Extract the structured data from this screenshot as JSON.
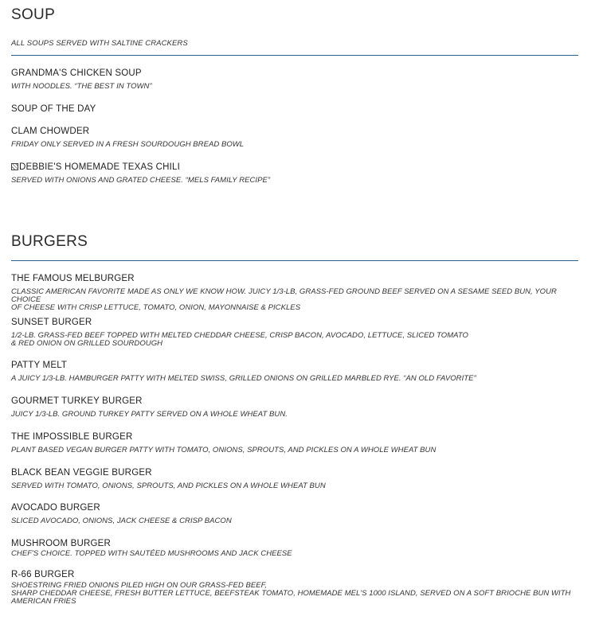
{
  "soup": {
    "title": "SOUP",
    "note": "ALL SOUPS SERVED WITH SALTINE CRACKERS",
    "items": [
      {
        "name": "GRANDMA'S CHICKEN SOUP",
        "desc": "WITH NOODLES. “THE BEST IN TOWN”"
      },
      {
        "name": "SOUP OF THE DAY",
        "desc": ""
      },
      {
        "name": "CLAM CHOWDER",
        "desc": "FRIDAY ONLY SERVED IN A FRESH SOURDOUGH BREAD BOWL"
      },
      {
        "name": "DEBBIE'S HOMEMADE TEXAS CHILI",
        "desc": "SERVED WITH ONIONS AND GRATED CHEESE. “MELS FAMILY RECIPE”",
        "icon": "missing-glyph-icon"
      }
    ]
  },
  "burgers": {
    "title": "BURGERS",
    "items": [
      {
        "name": "THE FAMOUS MELBURGER",
        "desc": "CLASSIC AMERICAN FAVORITE MADE AS ONLY WE KNOW HOW. JUICY 1/3-LB, GRASS-FED GROUND BEEF SERVED ON A SESAME SEED BUN, YOUR CHOICE\nOF CHEESE WITH CRISP LETTUCE, TOMATO, ONION, MAYONNAISE & PICKLES"
      },
      {
        "name": "SUNSET BURGER",
        "desc": "1/2-LB. GRASS-FED BEEF TOPPED WITH MELTED CHEDDAR CHEESE, CRISP BACON, AVOCADO, LETTUCE, SLICED TOMATO\n& RED ONION ON GRILLED SOURDOUGH"
      },
      {
        "name": "PATTY MELT",
        "desc": "A JUICY 1/3-LB. HAMBURGER PATTY WITH MELTED SWISS, GRILLED ONIONS ON GRILLED MARBLED RYE. “AN OLD FAVORITE”"
      },
      {
        "name": "GOURMET TURKEY BURGER",
        "desc": "JUICY 1/3-LB. GROUND TURKEY PATTY SERVED ON A WHOLE WHEAT BUN."
      },
      {
        "name": "THE IMPOSSIBLE BURGER",
        "desc": "PLANT BASED VEGAN BURGER PATTY WITH TOMATO, ONIONS, SPROUTS, AND PICKLES ON A WHOLE WHEAT BUN"
      },
      {
        "name": "BLACK BEAN VEGGIE BURGER",
        "desc": "SERVED WITH TOMATO, ONIONS, SPROUTS, AND PICKLES ON A WHOLE WHEAT BUN"
      },
      {
        "name": "AVOCADO BURGER",
        "desc": "SLICED AVOCADO, ONIONS, JACK CHEESE & CRISP BACON"
      },
      {
        "name": "MUSHROOM BURGER",
        "desc": "CHEF'S CHOICE. TOPPED WITH SAUTÉED MUSHROOMS AND JACK CHEESE"
      },
      {
        "name": "R-66 BURGER",
        "desc": "SHOESTRING FRIED ONIONS PILED HIGH ON OUR GRASS-FED BEEF,\nSHARP CHEDDAR CHEESE, FRESH BUTTER LETTUCE, BEEFSTEAK TOMATO, HOMEMADE MEL'S 1000 ISLAND, SERVED ON A SOFT BRIOCHE BUN WITH\nAMERICAN FRIES"
      }
    ]
  },
  "colors": {
    "rule": "#2f5f8f",
    "text": "#1e1e1e"
  }
}
